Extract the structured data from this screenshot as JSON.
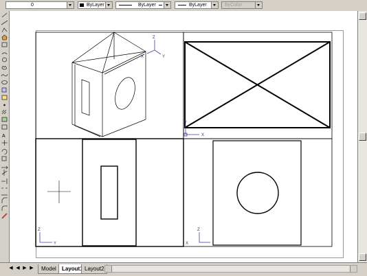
{
  "toolbar": {
    "layer_value": "0",
    "color_value": "ByLayer",
    "linetype_value": "ByLayer",
    "lineweight_value": "ByLayer",
    "plotstyle_value": "ByColor",
    "icons": [
      "layer-on-icon",
      "layer-freeze-icon",
      "layer-lock-icon",
      "layer-color-icon"
    ]
  },
  "left_toolbar": {
    "icons": [
      "line-icon",
      "construction-line-icon",
      "polyline-icon",
      "polygon-icon",
      "rectangle-icon",
      "arc-icon",
      "circle-icon",
      "revision-cloud-icon",
      "spline-icon",
      "ellipse-icon",
      "insert-block-icon",
      "make-block-icon",
      "point-icon",
      "hatch-icon",
      "region-icon",
      "table-icon",
      "multiline-text-icon",
      "move-icon",
      "rotate-icon",
      "scale-icon",
      "stretch-icon",
      "trim-icon",
      "extend-icon",
      "break-icon",
      "join-icon",
      "chamfer-icon",
      "fillet-icon",
      "explode-icon"
    ]
  },
  "viewports": {
    "iso_ucs": {
      "x": "X",
      "y": "Y",
      "z": "Z"
    },
    "top_ucs": {
      "x": "X",
      "y": "Y"
    },
    "front_ucs": {
      "y": "Y",
      "z": "Z"
    },
    "side_ucs": {
      "x": "X",
      "z": "Z"
    }
  },
  "tabs": [
    {
      "label": "Model",
      "active": false
    },
    {
      "label": "Layout1",
      "active": true
    },
    {
      "label": "Layout2",
      "active": false
    }
  ],
  "nav": [
    "first",
    "prev",
    "next",
    "last"
  ]
}
